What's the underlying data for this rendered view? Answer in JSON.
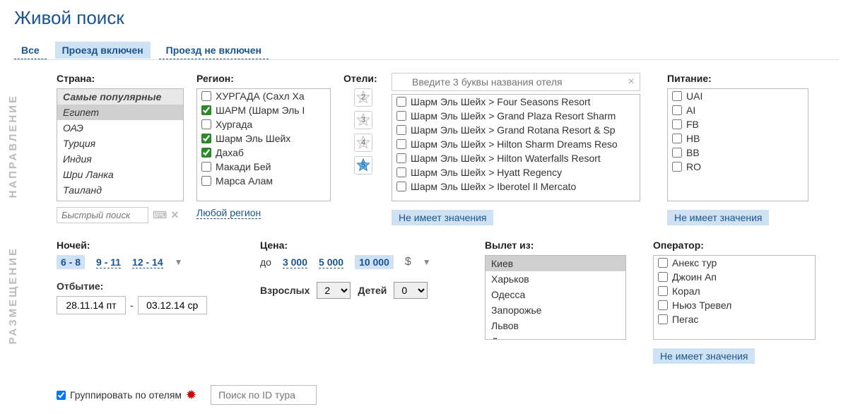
{
  "title": "Живой поиск",
  "tabs": {
    "all": "Все",
    "included": "Проезд включен",
    "excluded": "Проезд не включен"
  },
  "sideLabels": {
    "direction": "НАПРАВЛЕНИЕ",
    "placement": "РАЗМЕЩЕНИЕ"
  },
  "country": {
    "label": "Страна:",
    "groupHeader": "Самые популярные",
    "items": [
      "Египет",
      "ОАЭ",
      "Турция",
      "Индия",
      "Шри Ланка",
      "Таиланд"
    ],
    "quickPlaceholder": "Быстрый поиск"
  },
  "region": {
    "label": "Регион:",
    "items": [
      {
        "label": "ХУРГАДА (Сахл Ха",
        "checked": false
      },
      {
        "label": "ШАРМ (Шарм Эль I",
        "checked": true
      },
      {
        "label": "Хургада",
        "checked": false
      },
      {
        "label": "Шарм Эль Шейх",
        "checked": true
      },
      {
        "label": "Дахаб",
        "checked": true
      },
      {
        "label": "Макади Бей",
        "checked": false
      },
      {
        "label": "Марса Алам",
        "checked": false
      }
    ],
    "anyRegion": "Любой регион"
  },
  "hotels": {
    "label": "Отели:",
    "placeholder": "Введите 3 буквы названия отеля",
    "items": [
      "Шарм Эль Шейх > Four Seasons Resort",
      "Шарм Эль Шейх > Grand Plaza Resort Sharm",
      "Шарм Эль Шейх > Grand Rotana Resort & Sp",
      "Шарм Эль Шейх > Hilton Sharm Dreams Reso",
      "Шарм Эль Шейх > Hilton Waterfalls Resort",
      "Шарм Эль Шейх > Hyatt Regency",
      "Шарм Эль Шейх > Iberotel Il Mercato"
    ],
    "irrelevant": "Не имеет значения"
  },
  "meals": {
    "label": "Питание:",
    "items": [
      "UAI",
      "AI",
      "FB",
      "HB",
      "BB",
      "RO"
    ],
    "irrelevant": "Не имеет значения"
  },
  "nights": {
    "label": "Ночей:",
    "opts": [
      "6 - 8",
      "9 - 11",
      "12 - 14"
    ]
  },
  "departure": {
    "label": "Отбытие:",
    "from": "28.11.14 пт",
    "to": "03.12.14 ср",
    "dash": "-"
  },
  "price": {
    "label": "Цена:",
    "prefix": "до",
    "opts": [
      "3 000",
      "5 000",
      "10 000"
    ],
    "currency": "$"
  },
  "adults": {
    "label": "Взрослых",
    "value": "2"
  },
  "children": {
    "label": "Детей",
    "value": "0"
  },
  "flyFrom": {
    "label": "Вылет из:",
    "items": [
      "Киев",
      "Харьков",
      "Одесса",
      "Запорожье",
      "Львов",
      "Днепропетровск"
    ]
  },
  "operator": {
    "label": "Оператор:",
    "items": [
      "Анекс тур",
      "Джоин Ап",
      "Корал",
      "Ньюз Тревел",
      "Пегас"
    ],
    "irrelevant": "Не имеет значения"
  },
  "groupByHotels": "Группировать по отелям",
  "tourIdPlaceholder": "Поиск по ID тура"
}
